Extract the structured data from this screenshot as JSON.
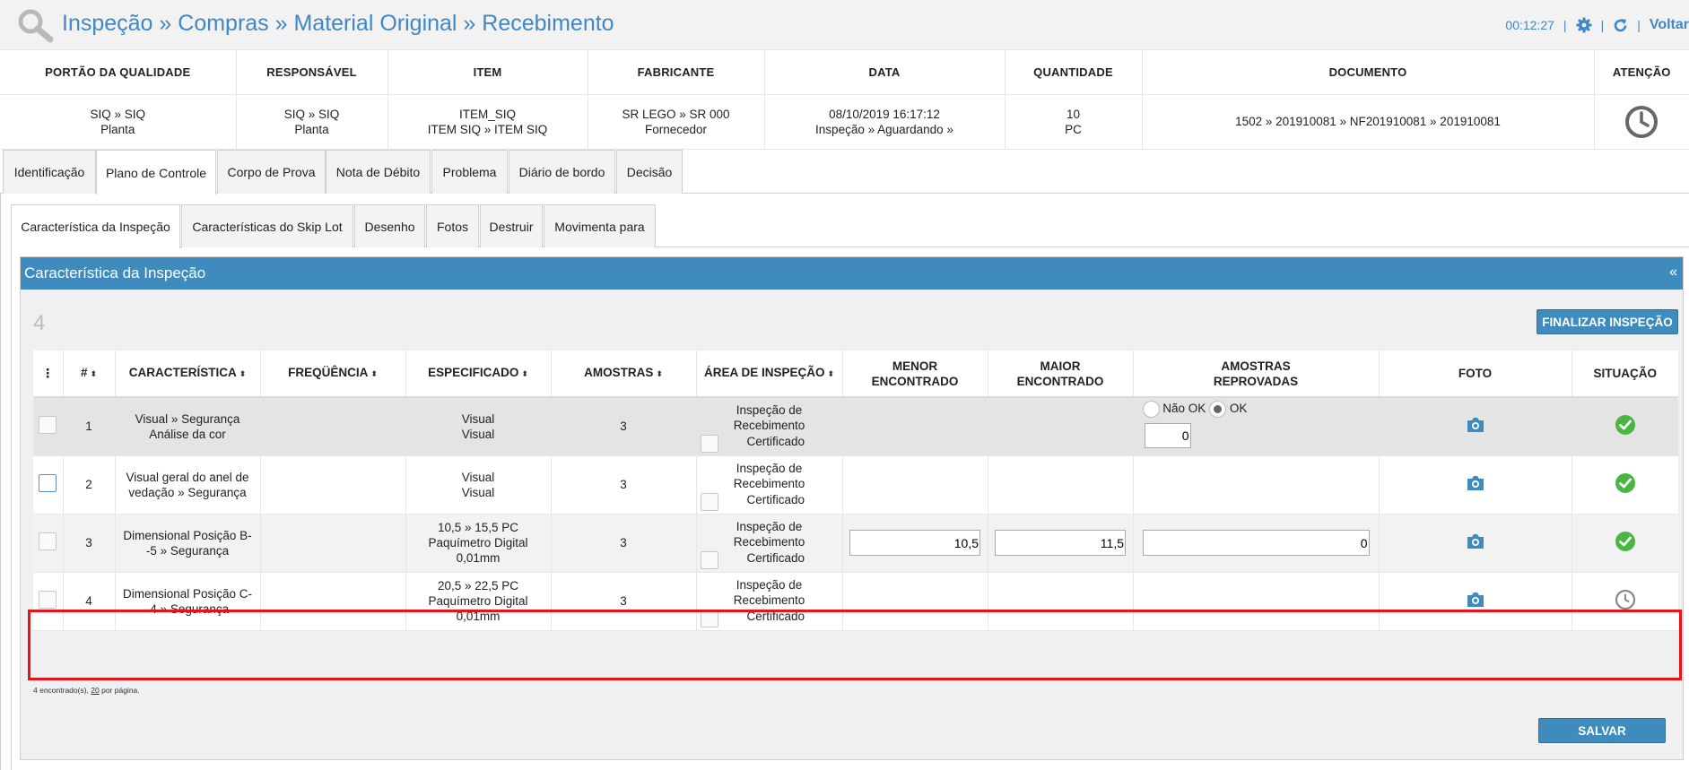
{
  "header": {
    "title": "Inspeção » Compras » Material Original » Recebimento",
    "timer": "00:12:27",
    "separator": "|",
    "back_label": "Voltar",
    "accent_color": "#3f88c5"
  },
  "info": {
    "columns": [
      "PORTÃO DA QUALIDADE",
      "RESPONSÁVEL",
      "ITEM",
      "FABRICANTE",
      "DATA",
      "QUANTIDADE",
      "DOCUMENTO",
      "ATENÇÃO"
    ],
    "values": {
      "portao_1": "SIQ » SIQ",
      "portao_2": "Planta",
      "resp_1": "SIQ » SIQ",
      "resp_2": "Planta",
      "item_1": "ITEM_SIQ",
      "item_2": "ITEM SIQ » ITEM SIQ",
      "fab_1": "SR LEGO » SR 000",
      "fab_2": "Fornecedor",
      "data_1": "08/10/2019 16:17:12",
      "data_2": "Inspeção » Aguardando »",
      "qtd_1": "10",
      "qtd_2": "PC",
      "documento": "1502 » 201910081 » NF201910081 » 201910081",
      "atencao_icon": "clock-icon"
    }
  },
  "tabs": [
    "Identificação",
    "Plano de Controle",
    "Corpo de Prova",
    "Nota de Débito",
    "Problema",
    "Diário de bordo",
    "Decisão"
  ],
  "subtabs": [
    "Característica da Inspeção",
    "Características do Skip Lot",
    "Desenho",
    "Fotos",
    "Destruir",
    "Movimenta para"
  ],
  "panel": {
    "title": "Característica da Inspeção",
    "collapse": "«",
    "count": "4",
    "finalize_label": "FINALIZAR INSPEÇÃO",
    "save_label": "SALVAR",
    "footer_note_prefix": "4 encontrado(s), ",
    "footer_note_link": "20",
    "footer_note_suffix": " por página.",
    "menu_glyph": "⋮",
    "sort_glyph": "⬍"
  },
  "grid": {
    "headers": {
      "num": "#",
      "caracteristica": "CARACTERÍSTICA",
      "frequencia": "FREQÜÊNCIA",
      "especificado": "ESPECIFICADO",
      "amostras": "AMOSTRAS",
      "area": "ÁREA DE INSPEÇÃO",
      "menor_1": "MENOR",
      "menor_2": "ENCONTRADO",
      "maior_1": "MAIOR",
      "maior_2": "ENCONTRADO",
      "reprov_1": "AMOSTRAS",
      "reprov_2": "REPROVADAS",
      "foto": "FOTO",
      "situacao": "SITUAÇÃO"
    },
    "rows": [
      {
        "num": "1",
        "car_1": "Visual » Segurança",
        "car_2": "Análise da cor",
        "esp_1": "Visual",
        "esp_2": "Visual",
        "esp_3": "",
        "amostras": "3",
        "area_1": "Inspeção de",
        "area_2": "Recebimento",
        "cert": "Certificado",
        "nao_ok": "Não OK",
        "ok": "OK",
        "reprov_value": "0",
        "status": "ok"
      },
      {
        "num": "2",
        "car_1": "Visual geral do anel de",
        "car_2": "vedação » Segurança",
        "esp_1": "Visual",
        "esp_2": "Visual",
        "esp_3": "",
        "amostras": "3",
        "area_1": "Inspeção de",
        "area_2": "Recebimento",
        "cert": "Certificado",
        "status": "ok"
      },
      {
        "num": "3",
        "car_1": "Dimensional Posição B-",
        "car_2": "-5 » Segurança",
        "esp_1": "10,5 » 15,5 PC",
        "esp_2": "Paquímetro Digital",
        "esp_3": "0,01mm",
        "amostras": "3",
        "area_1": "Inspeção de",
        "area_2": "Recebimento",
        "cert": "Certificado",
        "menor": "10,5",
        "maior": "11,5",
        "reprov_value": "0",
        "status": "ok"
      },
      {
        "num": "4",
        "car_1": "Dimensional Posição C-",
        "car_2": "-4 » Segurança",
        "esp_1": "20,5 » 22,5 PC",
        "esp_2": "Paquímetro Digital",
        "esp_3": "0,01mm",
        "amostras": "3",
        "area_1": "Inspeção de",
        "area_2": "Recebimento",
        "cert": "Certificado",
        "status": "pending"
      }
    ]
  },
  "colors": {
    "brand_blue": "#3f8bbd",
    "ok_green": "#4bb543",
    "highlight_red": "#e8121b"
  }
}
